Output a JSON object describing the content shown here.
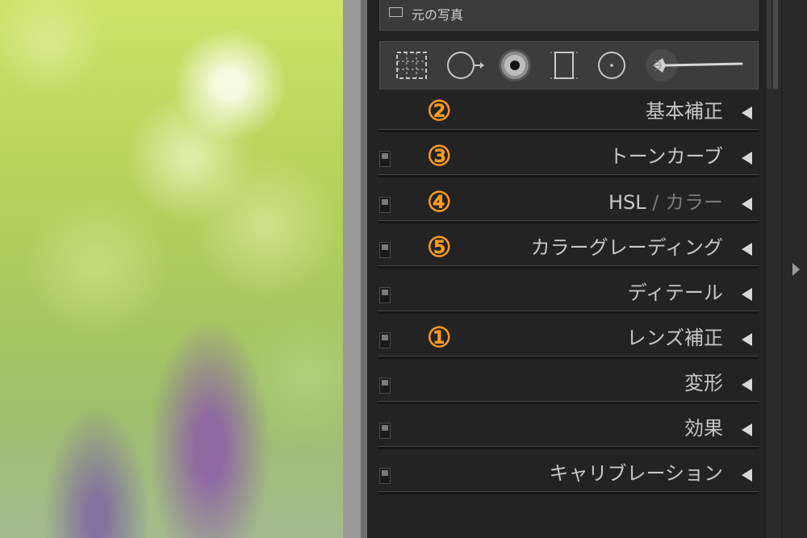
{
  "photo": {
    "alt": "blurred green bokeh photo with purple flowers"
  },
  "original_photo": {
    "label": "元の写真"
  },
  "toolbar": {
    "tools": [
      {
        "name": "crop-overlay-icon"
      },
      {
        "name": "spot-removal-icon"
      },
      {
        "name": "red-eye-icon"
      },
      {
        "name": "graduated-filter-icon"
      },
      {
        "name": "radial-filter-icon"
      },
      {
        "name": "adjustment-brush-icon"
      }
    ]
  },
  "panels": [
    {
      "id": "basic",
      "label": "基本補正",
      "number": "②",
      "has_switch": false
    },
    {
      "id": "tone-curve",
      "label": "トーンカーブ",
      "number": "③",
      "has_switch": true
    },
    {
      "id": "hsl",
      "label_main": "HSL",
      "label_sep": " / ",
      "label_dim": "カラー",
      "number": "④",
      "has_switch": true
    },
    {
      "id": "color-grading",
      "label": "カラーグレーディング",
      "number": "⑤",
      "has_switch": true
    },
    {
      "id": "detail",
      "label": "ディテール",
      "number": "",
      "has_switch": true
    },
    {
      "id": "lens",
      "label": "レンズ補正",
      "number": "①",
      "has_switch": true
    },
    {
      "id": "transform",
      "label": "変形",
      "number": "",
      "has_switch": true
    },
    {
      "id": "effects",
      "label": "効果",
      "number": "",
      "has_switch": true
    },
    {
      "id": "calibration",
      "label": "キャリブレーション",
      "number": "",
      "has_switch": true
    }
  ],
  "colors": {
    "accent_number": "#ff9a1e",
    "panel_bg": "#232323",
    "label": "#c7c7c7"
  }
}
